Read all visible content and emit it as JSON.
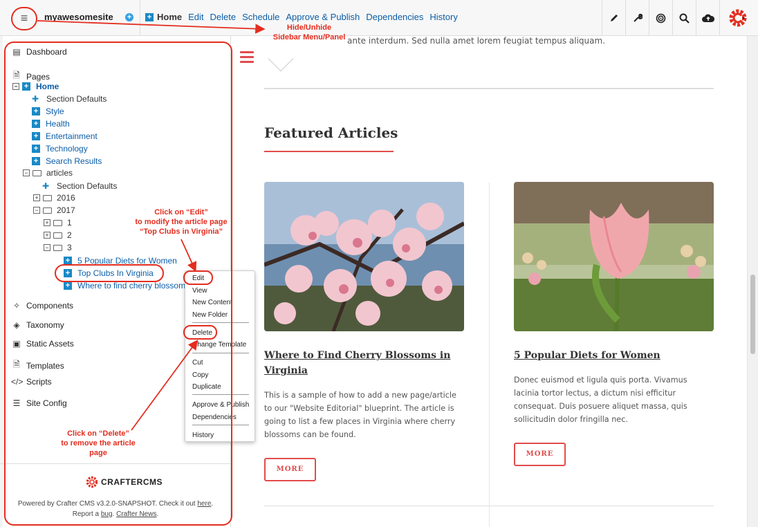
{
  "topbar": {
    "site_name": "myawesomesite",
    "nav_home": "Home",
    "nav_items": [
      "Edit",
      "Delete",
      "Schedule",
      "Approve & Publish",
      "Dependencies",
      "History"
    ],
    "tools": [
      "pencil-icon",
      "wrench-icon",
      "target-icon",
      "search-icon",
      "cloud-upload-icon"
    ]
  },
  "sidebar": {
    "dashboard": "Dashboard",
    "pages": "Pages",
    "tree": {
      "home": "Home",
      "section_defaults": "Section Defaults",
      "style": "Style",
      "health": "Health",
      "entertainment": "Entertainment",
      "technology": "Technology",
      "search_results": "Search Results",
      "articles": "articles",
      "articles_section_defaults": "Section Defaults",
      "y2016": "2016",
      "y2017": "2017",
      "m1": "1",
      "m2": "2",
      "m3": "3",
      "a1": "5 Popular Diets for Women",
      "a2": "Top Clubs In Virginia",
      "a3": "Where to find cherry blossom"
    },
    "components": "Components",
    "taxonomy": "Taxonomy",
    "static_assets": "Static Assets",
    "templates": "Templates",
    "scripts": "Scripts",
    "site_config": "Site Config",
    "footer": {
      "logo_text": "CRAFTERCMS",
      "powered": "Powered by Crafter CMS v3.2.0-SNAPSHOT. Check it out",
      "here": "here",
      "report": "Report a",
      "bug": "bug",
      "news": "Crafter News"
    }
  },
  "context_menu": {
    "items": [
      "Edit",
      "View",
      "New Content",
      "New Folder",
      "Delete",
      "Change Template",
      "Cut",
      "Copy",
      "Duplicate",
      "Approve & Publish",
      "Dependencies",
      "History"
    ]
  },
  "preview": {
    "lead_text": "ante interdum. Sed nulla amet lorem feugiat tempus aliquam.",
    "featured_title": "Featured Articles",
    "card1": {
      "title_line1": "Where to Find Cherry Blossoms in",
      "title_line2": "Virginia",
      "text": "This is a sample of how to add a new page/article to our \"Website Editorial\" blueprint. The article is going to list a few places in Virginia where cherry blossoms can be found.",
      "more": "MORE"
    },
    "card2": {
      "title": "5 Popular Diets for Women",
      "text": "Donec euismod et ligula quis porta. Vivamus lacinia tortor lectus, a dictum nisi efficitur consequat. Duis posuere aliquet massa, quis sollicitudin dolor fringilla nec.",
      "more": "MORE"
    }
  },
  "annotations": {
    "hide_line1": "Hide/Unhide",
    "hide_line2": "Sidebar Menu/Panel",
    "edit_line1": "Click on “Edit”",
    "edit_line2": "to modify the article page",
    "edit_line3": "“Top Clubs in Virginia”",
    "delete_line1": "Click on “Delete”",
    "delete_line2": "to remove the article",
    "delete_line3": "page"
  },
  "colors": {
    "accent_red": "#e24b4b",
    "annotation_red": "#e32d1f",
    "link_blue": "#0b5ea8"
  }
}
